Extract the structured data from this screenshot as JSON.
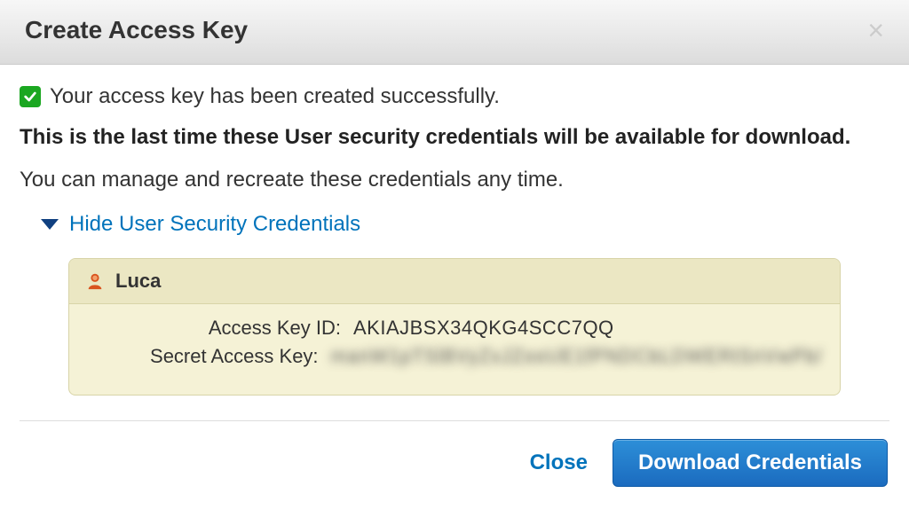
{
  "header": {
    "title": "Create Access Key"
  },
  "messages": {
    "success": "Your access key has been created successfully.",
    "warning": "This is the last time these User security credentials will be available for download.",
    "info": "You can manage and recreate these credentials any time."
  },
  "toggle": {
    "label": "Hide User Security Credentials"
  },
  "credentials": {
    "user_name": "Luca",
    "access_key_id_label": "Access Key ID:",
    "access_key_id_value": "AKIAJBSX34QKG4SCC7QQ",
    "secret_access_key_label": "Secret Access Key:",
    "secret_access_key_value": "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"
  },
  "footer": {
    "close_label": "Close",
    "download_label": "Download Credentials"
  }
}
